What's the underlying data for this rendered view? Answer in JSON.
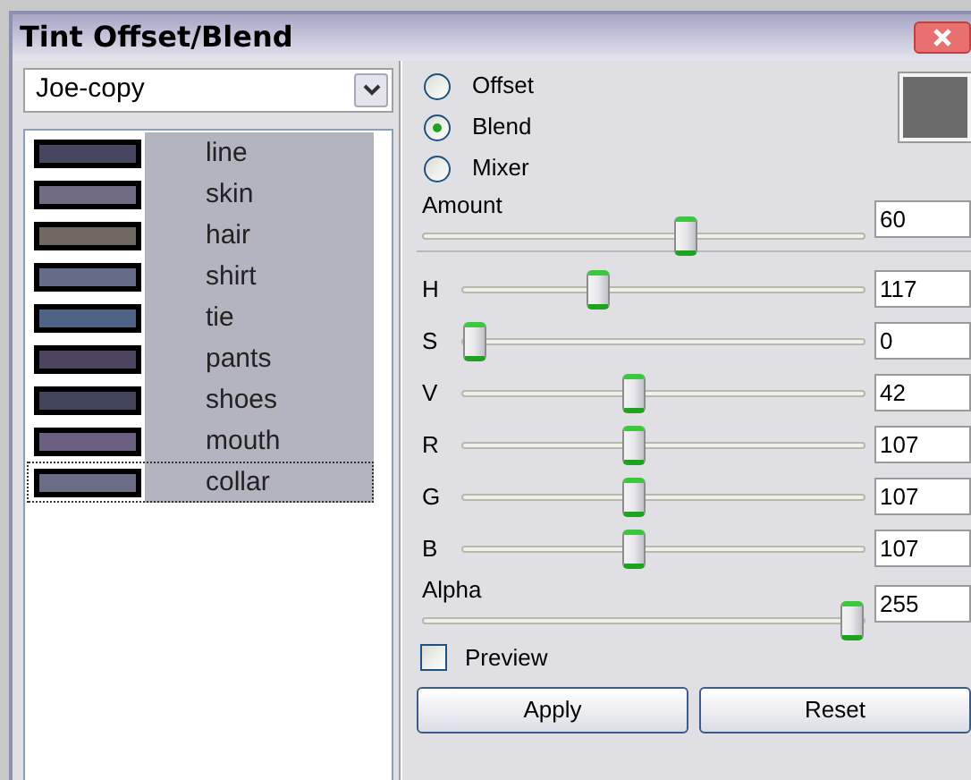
{
  "window": {
    "title": "Tint Offset/Blend"
  },
  "palette_dropdown": {
    "value": "Joe-copy"
  },
  "swatches": [
    {
      "label": "line",
      "color": "#464660",
      "selected": false
    },
    {
      "label": "skin",
      "color": "#716c84",
      "selected": false
    },
    {
      "label": "hair",
      "color": "#6f6860",
      "selected": false
    },
    {
      "label": "shirt",
      "color": "#656c87",
      "selected": false
    },
    {
      "label": "tie",
      "color": "#4e6285",
      "selected": false
    },
    {
      "label": "pants",
      "color": "#4d445f",
      "selected": false
    },
    {
      "label": "shoes",
      "color": "#43435a",
      "selected": false
    },
    {
      "label": "mouth",
      "color": "#6c6080",
      "selected": false
    },
    {
      "label": "collar",
      "color": "#6b6c86",
      "selected": true
    }
  ],
  "modes": [
    {
      "label": "Offset",
      "selected": false
    },
    {
      "label": "Blend",
      "selected": true
    },
    {
      "label": "Mixer",
      "selected": false
    }
  ],
  "color_preview": {
    "color": "#6b6b6b"
  },
  "amount": {
    "label": "Amount",
    "level": 0.6,
    "value": "60"
  },
  "channels": [
    {
      "label": "H",
      "level": 0.325,
      "value": "117"
    },
    {
      "label": "S",
      "level": 0,
      "value": "0"
    },
    {
      "label": "V",
      "level": 0.42,
      "value": "42"
    },
    {
      "label": "R",
      "level": 0.42,
      "value": "107"
    },
    {
      "label": "G",
      "level": 0.42,
      "value": "107"
    },
    {
      "label": "B",
      "level": 0.42,
      "value": "107"
    }
  ],
  "alpha": {
    "label": "Alpha",
    "level": 1,
    "value": "255"
  },
  "preview": {
    "label": "Preview",
    "checked": false
  },
  "buttons": [
    "Apply",
    "Reset"
  ]
}
